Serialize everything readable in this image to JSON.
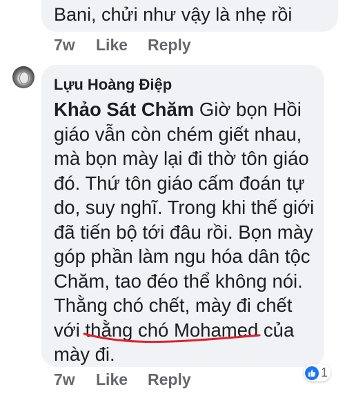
{
  "previous_comment": {
    "text": "Bani, chửi như vậy là nhẹ rồi",
    "time": "7w",
    "like_label": "Like",
    "reply_label": "Reply"
  },
  "comment": {
    "author": "Lựu Hoàng Điệp",
    "mention": "Khảo Sát Chăm",
    "lines": [
      " Giờ bọn Hồi",
      "giáo vẫn còn chém giết nhau,",
      "mà bọn mày lại đi thờ tôn giáo",
      "đó. Thứ tôn giáo cấm đoán tự",
      "do, suy nghĩ. Trong khi thế giới",
      "đã tiến bộ tới đâu rồi. Bọn mày",
      "góp phần làm ngu hóa dân tộc",
      "Chăm, tao đéo thể không nói.",
      "Thằng chó chết, mày đi chết",
      "với thằng chó Mohamed của",
      "mày đi."
    ],
    "time": "7w",
    "like_label": "Like",
    "reply_label": "Reply",
    "reaction_count": "1",
    "reaction_icon": "thumbs-up-icon"
  },
  "colors": {
    "bubble": "#f0f2f5",
    "meta_text": "#65676b",
    "like_blue": "#1877f2",
    "annotation_red": "#e0202a"
  }
}
